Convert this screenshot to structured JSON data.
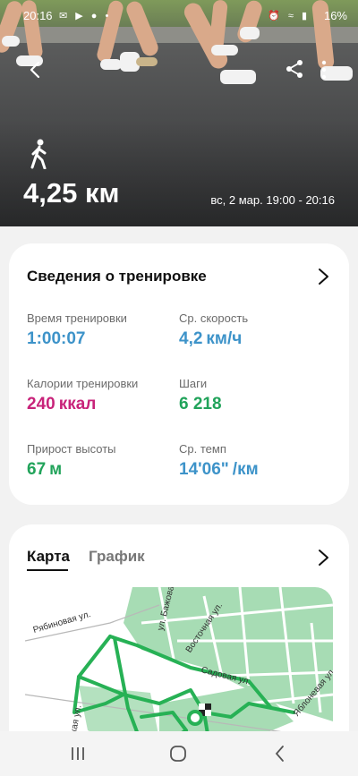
{
  "status_bar": {
    "time": "20:16",
    "battery": "16%"
  },
  "hero": {
    "activity_icon": "walking-person-icon",
    "distance": "4,25 км",
    "date_time": "вс, 2 мар. 19:00 - 20:16"
  },
  "summary": {
    "title": "Сведения о тренировке",
    "stats": [
      {
        "label": "Время тренировки",
        "value": "1:00:07",
        "unit": "",
        "color": "#3d93c9"
      },
      {
        "label": "Ср. скорость",
        "value": "4,2",
        "unit": "км/ч",
        "color": "#3d93c9"
      },
      {
        "label": "Калории тренировки",
        "value": "240",
        "unit": "ккал",
        "color": "#c8237a"
      },
      {
        "label": "Шаги",
        "value": "6 218",
        "unit": "",
        "color": "#21a35a"
      },
      {
        "label": "Прирост высоты",
        "value": "67",
        "unit": "м",
        "color": "#21a35a"
      },
      {
        "label": "Ср. темп",
        "value": "14'06\"",
        "unit": "/км",
        "color": "#3d93c9"
      }
    ]
  },
  "map_card": {
    "tabs": [
      "Карта",
      "График"
    ],
    "streets": [
      "Рябиновая ул.",
      "ул. Бажова",
      "Восточная ул.",
      "Садовая ул.",
      "Яблоневая ул.",
      "айская ул."
    ]
  },
  "colors": {
    "route": "#27b155",
    "map_green": "#a7dcb4"
  },
  "navbar": {
    "icons": [
      "recent-apps-icon",
      "home-icon",
      "back-icon"
    ]
  }
}
